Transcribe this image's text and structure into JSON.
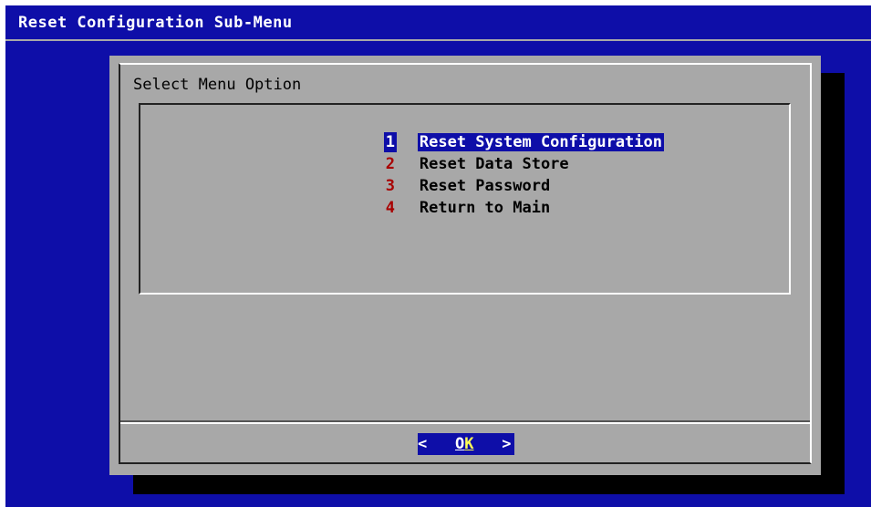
{
  "backtitle": "Reset Configuration Sub-Menu",
  "dialog": {
    "prompt": "Select Menu Option",
    "items": [
      {
        "tag": "1",
        "label": "Reset System Configuration",
        "selected": true
      },
      {
        "tag": "2",
        "label": "Reset Data Store",
        "selected": false
      },
      {
        "tag": "3",
        "label": "Reset Password",
        "selected": false
      },
      {
        "tag": "4",
        "label": "Return to Main",
        "selected": false
      }
    ],
    "ok_button": {
      "left_bracket": "<",
      "hotkey": "O",
      "rest": "K",
      "right_bracket": ">"
    }
  },
  "colors": {
    "background": "#0e0ea8",
    "dialog": "#a8a8a8",
    "tag": "#a80000",
    "selection": "#0e0ea8",
    "hotkey": "#ffff55"
  }
}
